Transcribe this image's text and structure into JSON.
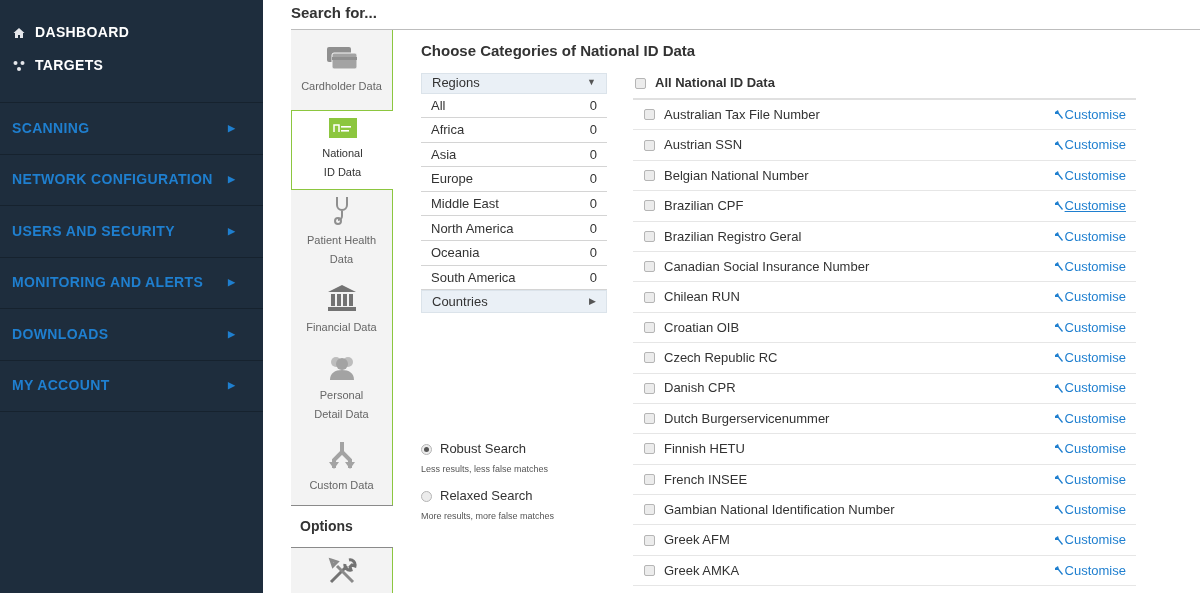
{
  "sidebar": {
    "top_items": [
      {
        "kind": "home",
        "label": "DASHBOARD"
      },
      {
        "kind": "targets",
        "label": "TARGETS"
      }
    ],
    "sections": [
      {
        "label": "SCANNING",
        "arrow": "▶"
      },
      {
        "label": "NETWORK CONFIGURATION",
        "arrow": "▶"
      },
      {
        "label": "USERS AND SECURITY",
        "arrow": "▶"
      },
      {
        "label": "MONITORING AND ALERTS",
        "arrow": "▶"
      },
      {
        "label": "DOWNLOADS",
        "arrow": "▶"
      },
      {
        "label": "MY ACCOUNT",
        "arrow": "▶"
      }
    ]
  },
  "heading": "Search for...",
  "data_tabs": [
    {
      "kind": "card",
      "lines": [
        "Cardholder Data"
      ],
      "selected": false
    },
    {
      "kind": "id",
      "lines": [
        "National",
        "ID Data"
      ],
      "selected": true
    },
    {
      "kind": "health",
      "lines": [
        "Patient Health",
        "Data"
      ],
      "selected": false
    },
    {
      "kind": "bank",
      "lines": [
        "Financial Data"
      ],
      "selected": false
    },
    {
      "kind": "people",
      "lines": [
        "Personal",
        "Detail Data"
      ],
      "selected": false
    },
    {
      "kind": "custom",
      "lines": [
        "Custom Data"
      ],
      "selected": false
    }
  ],
  "options": {
    "label": "Options",
    "items": [
      {
        "kind": "tools"
      }
    ]
  },
  "categories": {
    "title": "Choose Categories of National ID Data",
    "regions_header": {
      "label": "Regions",
      "arrow": "▼"
    },
    "regions": [
      {
        "name": "All",
        "count": "0"
      },
      {
        "name": "Africa",
        "count": "0"
      },
      {
        "name": "Asia",
        "count": "0"
      },
      {
        "name": "Europe",
        "count": "0"
      },
      {
        "name": "Middle East",
        "count": "0"
      },
      {
        "name": "North America",
        "count": "0"
      },
      {
        "name": "Oceania",
        "count": "0"
      },
      {
        "name": "South America",
        "count": "0"
      }
    ],
    "countries_header": {
      "label": "Countries",
      "arrow": "▶"
    },
    "search_modes": [
      {
        "label": "Robust Search",
        "hint": "Less results, less false matches",
        "selected": true
      },
      {
        "label": "Relaxed Search",
        "hint": "More results, more false matches",
        "selected": false
      }
    ]
  },
  "id_list": {
    "all": {
      "label": "All National ID Data",
      "checked": false
    },
    "items": [
      {
        "name": "Australian Tax File Number",
        "checked": false,
        "action": "Customise",
        "hovered": false
      },
      {
        "name": "Austrian SSN",
        "checked": false,
        "action": "Customise",
        "hovered": false
      },
      {
        "name": "Belgian National Number",
        "checked": false,
        "action": "Customise",
        "hovered": false
      },
      {
        "name": "Brazilian CPF",
        "checked": false,
        "action": "Customise",
        "hovered": true
      },
      {
        "name": "Brazilian Registro Geral",
        "checked": false,
        "action": "Customise",
        "hovered": false
      },
      {
        "name": "Canadian Social Insurance Number",
        "checked": false,
        "action": "Customise",
        "hovered": false
      },
      {
        "name": "Chilean RUN",
        "checked": false,
        "action": "Customise",
        "hovered": false
      },
      {
        "name": "Croatian OIB",
        "checked": false,
        "action": "Customise",
        "hovered": false
      },
      {
        "name": "Czech Republic RC",
        "checked": false,
        "action": "Customise",
        "hovered": false
      },
      {
        "name": "Danish CPR",
        "checked": false,
        "action": "Customise",
        "hovered": false
      },
      {
        "name": "Dutch Burgerservicenummer",
        "checked": false,
        "action": "Customise",
        "hovered": false
      },
      {
        "name": "Finnish HETU",
        "checked": false,
        "action": "Customise",
        "hovered": false
      },
      {
        "name": "French INSEE",
        "checked": false,
        "action": "Customise",
        "hovered": false
      },
      {
        "name": "Gambian National Identification Number",
        "checked": false,
        "action": "Customise",
        "hovered": false
      },
      {
        "name": "Greek AFM",
        "checked": false,
        "action": "Customise",
        "hovered": false
      },
      {
        "name": "Greek AMKA",
        "checked": false,
        "action": "Customise",
        "hovered": false
      }
    ]
  }
}
